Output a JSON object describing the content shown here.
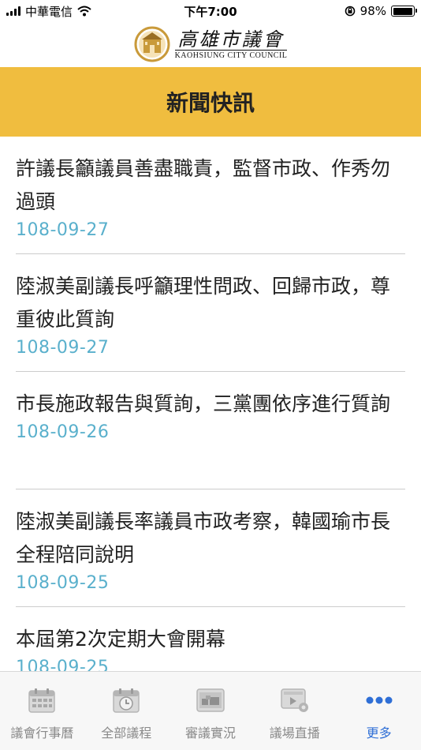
{
  "status_bar": {
    "carrier": "中華電信",
    "time": "下午7:00",
    "battery_percent": "98%",
    "battery_level": 0.98
  },
  "header": {
    "logo_zh": "高雄市議會",
    "logo_en": "KAOHSIUNG CITY COUNCIL"
  },
  "page": {
    "title": "新聞快訊"
  },
  "news": [
    {
      "title": "許議長籲議員善盡職責，監督市政、作秀勿過頭",
      "date": "108-09-27"
    },
    {
      "title": "陸淑美副議長呼籲理性問政、回歸市政，尊重彼此質詢",
      "date": "108-09-27"
    },
    {
      "title": "市長施政報告與質詢，三黨團依序進行質詢",
      "date": "108-09-26"
    },
    {
      "title": "陸淑美副議長率議員市政考察，韓國瑜市長全程陪同說明",
      "date": "108-09-25"
    },
    {
      "title": "本屆第2次定期大會開幕",
      "date": "108-09-25"
    }
  ],
  "tabs": [
    {
      "label": "議會行事曆",
      "icon": "calendar-icon"
    },
    {
      "label": "全部議程",
      "icon": "clock-icon"
    },
    {
      "label": "審議實況",
      "icon": "meeting-icon"
    },
    {
      "label": "議場直播",
      "icon": "video-icon"
    },
    {
      "label": "更多",
      "icon": "more-icon"
    }
  ],
  "colors": {
    "banner": "#f0bd3f",
    "date": "#5ab0cc",
    "active_tab": "#2f6fd6",
    "inactive_tab": "#8a8a8a"
  }
}
